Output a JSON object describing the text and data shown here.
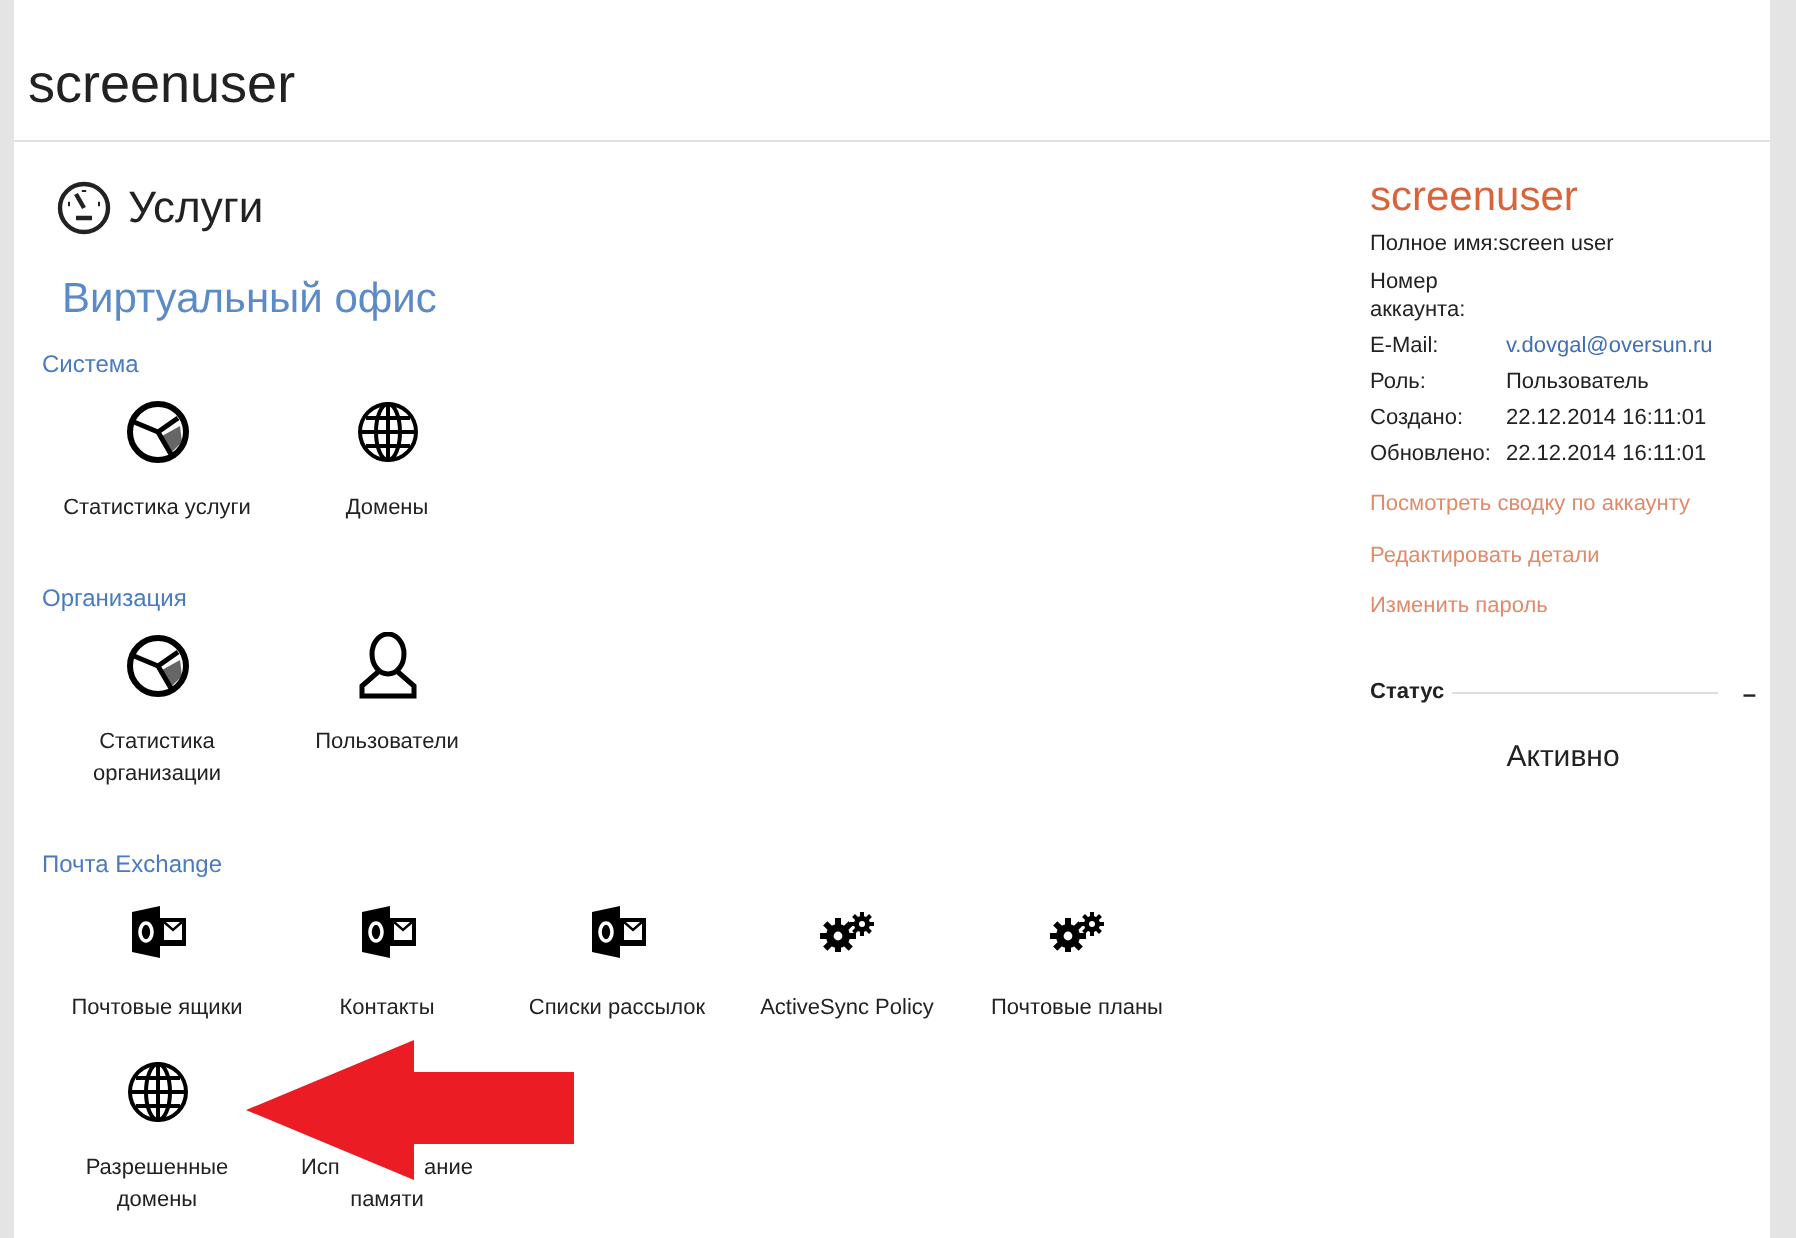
{
  "header": {
    "title": "screenuser"
  },
  "services": {
    "title": "Услуги",
    "subtitle": "Виртуальный офис",
    "groups": [
      {
        "title": "Система",
        "items": [
          {
            "label": "Статистика услуги",
            "kind": "chart"
          },
          {
            "label": "Домены",
            "kind": "globe"
          }
        ]
      },
      {
        "title": "Организация",
        "items": [
          {
            "label": "Статистика организации",
            "kind": "chart"
          },
          {
            "label": "Пользователи",
            "kind": "user"
          }
        ]
      },
      {
        "title": "Почта Exchange",
        "items": [
          {
            "label": "Почтовые ящики",
            "kind": "outlook"
          },
          {
            "label": "Контакты",
            "kind": "outlook"
          },
          {
            "label": "Списки рассылок",
            "kind": "outlook"
          },
          {
            "label": "ActiveSync Policy",
            "kind": "gears"
          },
          {
            "label": "Почтовые планы",
            "kind": "gears"
          },
          {
            "label": "Разрешенные домены",
            "kind": "globe"
          },
          {
            "fragments": [
              "Исп",
              "ание",
              "памяти"
            ],
            "kind": "covered"
          }
        ]
      }
    ]
  },
  "account": {
    "name": "screenuser",
    "fields": [
      {
        "label": "Полное имя:",
        "value": "screen user",
        "kind": "inline"
      },
      {
        "label": "Номер аккаунта:",
        "kind": "text"
      },
      {
        "label": "E-Mail:",
        "value": "v.dovgal@oversun.ru",
        "kind": "link"
      },
      {
        "label": "Роль:",
        "value": "Пользователь",
        "kind": "text"
      },
      {
        "label": "Создано:",
        "value": "22.12.2014 16:11:01",
        "kind": "text"
      },
      {
        "label": "Обновлено:",
        "value": "22.12.2014 16:11:01",
        "kind": "text"
      }
    ],
    "links": [
      "Посмотреть сводку по аккаунту",
      "Редактировать детали",
      "Изменить пароль"
    ],
    "status": {
      "title": "Статус",
      "toggle": "–",
      "value": "Активно"
    }
  }
}
